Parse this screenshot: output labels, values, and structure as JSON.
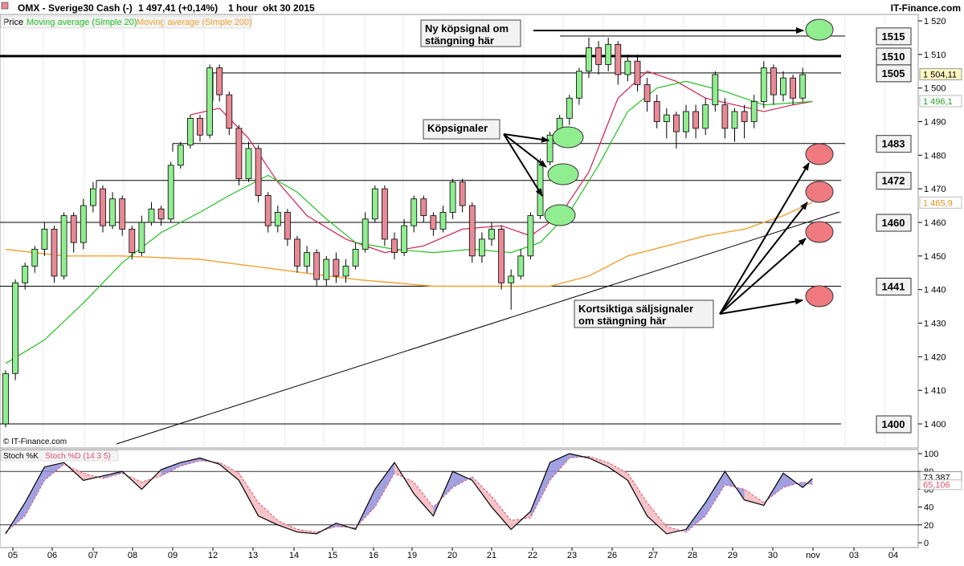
{
  "header": {
    "symbol": "OMX - Sverige30 Cash (-)",
    "quote": "1 497,41 (+0,14%)",
    "interval": "1 hour",
    "date": "okt 30 2015",
    "brand": "IT-Finance.com"
  },
  "legend": {
    "price": "Price",
    "ma20": "Moving average (Simple 20)",
    "ma200": "Moving average (Simple 200)",
    "stoch_k": "Stoch %K",
    "stoch_d": "Stoch %D (14 3 5)"
  },
  "copyright": "© IT-Finance.com",
  "colors": {
    "up": "#90ee90",
    "down": "#e88a96",
    "ma20": "#22c022",
    "ma200": "#f0a030",
    "k_line": "#000000",
    "d_line": "#e05070",
    "k_fill": "#9090dd",
    "d_fill": "#f4b8c0",
    "green_marker": "#90ee90",
    "red_marker": "#f07a80"
  },
  "chart_data": {
    "type": "candlestick",
    "x_labels": [
      "05",
      "06",
      "07",
      "08",
      "09",
      "12",
      "13",
      "14",
      "15",
      "16",
      "19",
      "20",
      "21",
      "22",
      "23",
      "26",
      "27",
      "28",
      "29",
      "30",
      "nov",
      "03",
      "04"
    ],
    "y_ticks": [
      1400,
      1410,
      1420,
      1430,
      1440,
      1450,
      1460,
      1470,
      1480,
      1490,
      1500,
      1510,
      1520
    ],
    "ylim": [
      1397,
      1523
    ],
    "last_price": "1 504,11",
    "ma20_value": "1 496,1",
    "ma200_value": "1 465,9",
    "candles": [
      [
        1400,
        1415,
        1399,
        1416
      ],
      [
        1415,
        1442,
        1413,
        1443
      ],
      [
        1442,
        1447,
        1440,
        1448
      ],
      [
        1447,
        1452,
        1445,
        1453
      ],
      [
        1452,
        1458,
        1450,
        1460
      ],
      [
        1458,
        1444,
        1442,
        1459
      ],
      [
        1444,
        1462,
        1443,
        1463
      ],
      [
        1462,
        1454,
        1451,
        1463
      ],
      [
        1454,
        1465,
        1452,
        1467
      ],
      [
        1465,
        1470,
        1463,
        1472
      ],
      [
        1470,
        1459,
        1457,
        1471
      ],
      [
        1459,
        1467,
        1458,
        1469
      ],
      [
        1467,
        1458,
        1456,
        1468
      ],
      [
        1458,
        1451,
        1449,
        1459
      ],
      [
        1451,
        1460,
        1450,
        1462
      ],
      [
        1460,
        1464,
        1459,
        1466
      ],
      [
        1464,
        1461,
        1459,
        1465
      ],
      [
        1461,
        1477,
        1460,
        1478
      ],
      [
        1477,
        1483,
        1476,
        1484
      ],
      [
        1483,
        1491,
        1482,
        1492
      ],
      [
        1491,
        1486,
        1484,
        1492
      ],
      [
        1486,
        1506,
        1485,
        1507
      ],
      [
        1506,
        1498,
        1496,
        1507
      ],
      [
        1498,
        1488,
        1486,
        1499
      ],
      [
        1488,
        1473,
        1471,
        1489
      ],
      [
        1473,
        1482,
        1472,
        1484
      ],
      [
        1482,
        1468,
        1466,
        1483
      ],
      [
        1468,
        1459,
        1457,
        1469
      ],
      [
        1459,
        1463,
        1457,
        1465
      ],
      [
        1463,
        1455,
        1453,
        1464
      ],
      [
        1455,
        1447,
        1445,
        1456
      ],
      [
        1447,
        1451,
        1445,
        1453
      ],
      [
        1451,
        1443,
        1441,
        1452
      ],
      [
        1443,
        1449,
        1441,
        1450
      ],
      [
        1449,
        1444,
        1442,
        1451
      ],
      [
        1444,
        1447,
        1442,
        1449
      ],
      [
        1447,
        1452,
        1446,
        1454
      ],
      [
        1452,
        1461,
        1451,
        1463
      ],
      [
        1461,
        1470,
        1460,
        1471
      ],
      [
        1470,
        1455,
        1453,
        1471
      ],
      [
        1455,
        1451,
        1449,
        1457
      ],
      [
        1451,
        1459,
        1450,
        1461
      ],
      [
        1459,
        1467,
        1457,
        1468
      ],
      [
        1467,
        1462,
        1460,
        1468
      ],
      [
        1462,
        1458,
        1456,
        1463
      ],
      [
        1458,
        1463,
        1457,
        1465
      ],
      [
        1463,
        1472,
        1461,
        1473
      ],
      [
        1472,
        1465,
        1463,
        1473
      ],
      [
        1465,
        1450,
        1448,
        1466
      ],
      [
        1450,
        1455,
        1448,
        1457
      ],
      [
        1455,
        1458,
        1453,
        1460
      ],
      [
        1458,
        1442,
        1440,
        1459
      ],
      [
        1442,
        1444,
        1434,
        1446
      ],
      [
        1444,
        1450,
        1443,
        1452
      ],
      [
        1450,
        1462,
        1449,
        1463
      ],
      [
        1462,
        1478,
        1461,
        1479
      ],
      [
        1478,
        1486,
        1477,
        1487
      ],
      [
        1486,
        1491,
        1484,
        1492
      ],
      [
        1491,
        1497,
        1489,
        1498
      ],
      [
        1497,
        1505,
        1495,
        1506
      ],
      [
        1505,
        1512,
        1503,
        1515
      ],
      [
        1512,
        1507,
        1504,
        1514
      ],
      [
        1507,
        1513,
        1505,
        1515
      ],
      [
        1513,
        1504,
        1501,
        1514
      ],
      [
        1504,
        1508,
        1502,
        1510
      ],
      [
        1508,
        1501,
        1499,
        1510
      ],
      [
        1501,
        1496,
        1493,
        1503
      ],
      [
        1496,
        1490,
        1488,
        1498
      ],
      [
        1490,
        1492,
        1485,
        1494
      ],
      [
        1492,
        1487,
        1482,
        1493
      ],
      [
        1487,
        1493,
        1485,
        1495
      ],
      [
        1493,
        1488,
        1485,
        1495
      ],
      [
        1488,
        1495,
        1486,
        1497
      ],
      [
        1495,
        1504,
        1493,
        1505
      ],
      [
        1495,
        1488,
        1485,
        1497
      ],
      [
        1488,
        1493,
        1484,
        1494
      ],
      [
        1493,
        1490,
        1485,
        1495
      ],
      [
        1490,
        1496,
        1488,
        1498
      ],
      [
        1496,
        1506,
        1494,
        1508
      ],
      [
        1506,
        1498,
        1495,
        1507
      ],
      [
        1498,
        1503,
        1496,
        1505
      ],
      [
        1503,
        1497,
        1495,
        1504
      ],
      [
        1497,
        1504,
        1496,
        1506
      ]
    ],
    "ma20": [
      [
        0,
        1418
      ],
      [
        4,
        1425
      ],
      [
        8,
        1436
      ],
      [
        12,
        1448
      ],
      [
        16,
        1457
      ],
      [
        20,
        1463
      ],
      [
        23,
        1468
      ],
      [
        27,
        1474
      ],
      [
        30,
        1469
      ],
      [
        33,
        1461
      ],
      [
        36,
        1454
      ],
      [
        40,
        1452
      ],
      [
        44,
        1451
      ],
      [
        48,
        1452
      ],
      [
        52,
        1451
      ],
      [
        55,
        1454
      ],
      [
        58,
        1463
      ],
      [
        61,
        1477
      ],
      [
        64,
        1493
      ],
      [
        67,
        1500
      ],
      [
        70,
        1502
      ],
      [
        74,
        1499
      ],
      [
        78,
        1495
      ],
      [
        83,
        1496
      ]
    ],
    "ma200": [
      [
        0,
        1452
      ],
      [
        6,
        1450
      ],
      [
        12,
        1450
      ],
      [
        20,
        1449
      ],
      [
        28,
        1446
      ],
      [
        36,
        1443
      ],
      [
        44,
        1441
      ],
      [
        52,
        1441
      ],
      [
        56,
        1441
      ],
      [
        60,
        1444
      ],
      [
        64,
        1450
      ],
      [
        68,
        1453
      ],
      [
        72,
        1456
      ],
      [
        76,
        1458
      ],
      [
        80,
        1462
      ],
      [
        83,
        1466
      ]
    ],
    "ma_red": [
      [
        19,
        1492
      ],
      [
        22,
        1494
      ],
      [
        25,
        1485
      ],
      [
        28,
        1472
      ],
      [
        31,
        1462
      ],
      [
        35,
        1455
      ],
      [
        39,
        1451
      ],
      [
        43,
        1453
      ],
      [
        47,
        1458
      ],
      [
        51,
        1459
      ],
      [
        54,
        1456
      ],
      [
        57,
        1462
      ],
      [
        60,
        1475
      ],
      [
        63,
        1497
      ],
      [
        66,
        1505
      ],
      [
        69,
        1502
      ],
      [
        72,
        1497
      ],
      [
        75,
        1495
      ],
      [
        78,
        1493
      ],
      [
        81,
        1495
      ],
      [
        83,
        1496
      ]
    ],
    "levels": [
      {
        "label": "1515",
        "value": 1515.5
      },
      {
        "label": "1510",
        "value": 1509.5
      },
      {
        "label": "1505",
        "value": 1504.5
      },
      {
        "label": "1483",
        "value": 1483.5
      },
      {
        "label": "1472",
        "value": 1472.5
      },
      {
        "label": "1460",
        "value": 1460
      },
      {
        "label": "1441",
        "value": 1441
      },
      {
        "label": "1400",
        "value": 1400
      }
    ],
    "stoch_ticks": [
      0,
      20,
      40,
      60,
      80,
      100
    ],
    "stoch_k_value": "73,387",
    "stoch_d_value": "65,106",
    "stoch_k": [
      [
        0,
        10
      ],
      [
        2,
        45
      ],
      [
        4,
        85
      ],
      [
        6,
        90
      ],
      [
        8,
        70
      ],
      [
        10,
        75
      ],
      [
        12,
        80
      ],
      [
        14,
        60
      ],
      [
        16,
        82
      ],
      [
        18,
        90
      ],
      [
        20,
        95
      ],
      [
        22,
        88
      ],
      [
        24,
        70
      ],
      [
        26,
        30
      ],
      [
        28,
        20
      ],
      [
        30,
        12
      ],
      [
        32,
        10
      ],
      [
        34,
        22
      ],
      [
        36,
        15
      ],
      [
        38,
        60
      ],
      [
        40,
        90
      ],
      [
        42,
        55
      ],
      [
        44,
        30
      ],
      [
        46,
        80
      ],
      [
        48,
        70
      ],
      [
        50,
        40
      ],
      [
        52,
        15
      ],
      [
        54,
        35
      ],
      [
        56,
        90
      ],
      [
        58,
        100
      ],
      [
        60,
        95
      ],
      [
        62,
        85
      ],
      [
        64,
        70
      ],
      [
        66,
        30
      ],
      [
        68,
        10
      ],
      [
        70,
        15
      ],
      [
        72,
        45
      ],
      [
        74,
        80
      ],
      [
        76,
        48
      ],
      [
        78,
        42
      ],
      [
        80,
        78
      ],
      [
        82,
        62
      ],
      [
        83,
        72
      ]
    ],
    "stoch_d": [
      [
        0,
        12
      ],
      [
        2,
        30
      ],
      [
        4,
        70
      ],
      [
        6,
        88
      ],
      [
        8,
        78
      ],
      [
        10,
        72
      ],
      [
        12,
        78
      ],
      [
        14,
        68
      ],
      [
        16,
        75
      ],
      [
        18,
        86
      ],
      [
        20,
        92
      ],
      [
        22,
        90
      ],
      [
        24,
        78
      ],
      [
        26,
        45
      ],
      [
        28,
        25
      ],
      [
        30,
        15
      ],
      [
        32,
        12
      ],
      [
        34,
        18
      ],
      [
        36,
        17
      ],
      [
        38,
        40
      ],
      [
        40,
        78
      ],
      [
        42,
        68
      ],
      [
        44,
        40
      ],
      [
        46,
        62
      ],
      [
        48,
        74
      ],
      [
        50,
        52
      ],
      [
        52,
        25
      ],
      [
        54,
        28
      ],
      [
        56,
        70
      ],
      [
        58,
        95
      ],
      [
        60,
        97
      ],
      [
        62,
        90
      ],
      [
        64,
        78
      ],
      [
        66,
        45
      ],
      [
        68,
        18
      ],
      [
        70,
        12
      ],
      [
        72,
        30
      ],
      [
        74,
        65
      ],
      [
        76,
        60
      ],
      [
        78,
        45
      ],
      [
        80,
        62
      ],
      [
        82,
        68
      ],
      [
        83,
        65
      ]
    ],
    "annotations": {
      "buy_signal_new": "Ny köpsignal om\nstängning här",
      "buy_signals": "Köpsignaler",
      "sell_signals": "Kortsiktiga säljsignaler\nom stängning här"
    }
  }
}
